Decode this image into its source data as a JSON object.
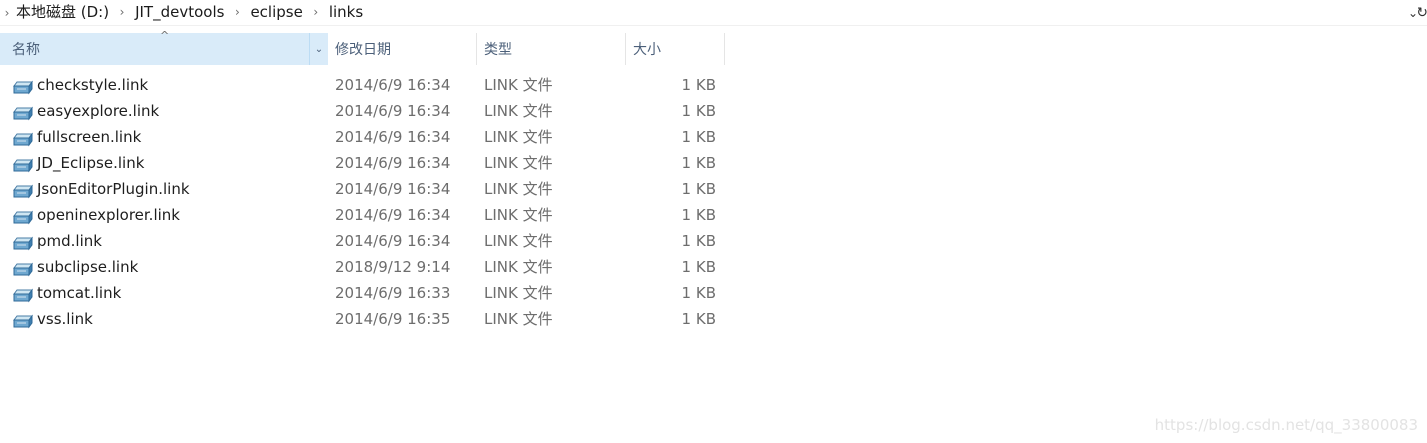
{
  "address_bar": {
    "breadcrumbs": [
      "本地磁盘 (D:)",
      "JIT_devtools",
      "eclipse",
      "links"
    ],
    "lead_arrow_icon": "chevron-right-icon",
    "dropdown_icon": "chevron-down-icon",
    "refresh_icon": "refresh-icon"
  },
  "columns": {
    "name": "名称",
    "date": "修改日期",
    "type": "类型",
    "size": "大小",
    "sort_column": "name",
    "sort_direction": "ascending"
  },
  "files": [
    {
      "name": "checkstyle.link",
      "date": "2014/6/9 16:34",
      "type": "LINK 文件",
      "size": "1 KB",
      "icon": "file-icon"
    },
    {
      "name": "easyexplore.link",
      "date": "2014/6/9 16:34",
      "type": "LINK 文件",
      "size": "1 KB",
      "icon": "file-icon"
    },
    {
      "name": "fullscreen.link",
      "date": "2014/6/9 16:34",
      "type": "LINK 文件",
      "size": "1 KB",
      "icon": "file-icon"
    },
    {
      "name": "JD_Eclipse.link",
      "date": "2014/6/9 16:34",
      "type": "LINK 文件",
      "size": "1 KB",
      "icon": "file-icon"
    },
    {
      "name": "JsonEditorPlugin.link",
      "date": "2014/6/9 16:34",
      "type": "LINK 文件",
      "size": "1 KB",
      "icon": "file-icon"
    },
    {
      "name": "openinexplorer.link",
      "date": "2014/6/9 16:34",
      "type": "LINK 文件",
      "size": "1 KB",
      "icon": "file-icon"
    },
    {
      "name": "pmd.link",
      "date": "2014/6/9 16:34",
      "type": "LINK 文件",
      "size": "1 KB",
      "icon": "file-icon"
    },
    {
      "name": "subclipse.link",
      "date": "2018/9/12 9:14",
      "type": "LINK 文件",
      "size": "1 KB",
      "icon": "file-icon"
    },
    {
      "name": "tomcat.link",
      "date": "2014/6/9 16:33",
      "type": "LINK 文件",
      "size": "1 KB",
      "icon": "file-icon"
    },
    {
      "name": "vss.link",
      "date": "2014/6/9 16:35",
      "type": "LINK 文件",
      "size": "1 KB",
      "icon": "file-icon"
    }
  ],
  "watermark": "https://blog.csdn.net/qq_33800083",
  "colors": {
    "header_selected_bg": "#d9ebf9",
    "header_text": "#4c607a",
    "secondary_text": "#6d6d6d"
  }
}
